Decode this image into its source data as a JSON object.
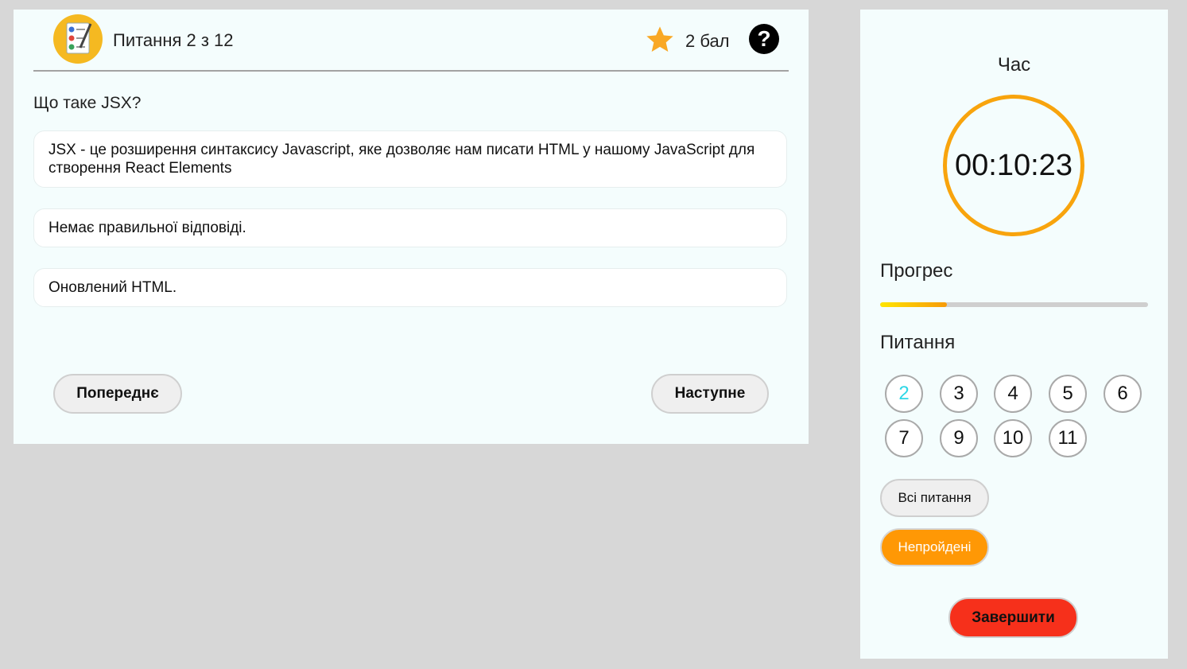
{
  "header": {
    "counter": "Питання 2 з 12",
    "points": "2 бал",
    "help": "?"
  },
  "question": {
    "text": "Що таке JSX?",
    "answers": [
      "JSX - це розширення синтаксису Javascript, яке дозволяє нам писати HTML у нашому JavaScript для створення React Elements",
      "Немає правильної відповіді.",
      "Оновлений HTML."
    ]
  },
  "nav": {
    "prev": "Попереднє",
    "next": "Наступне"
  },
  "sidebar": {
    "time_label": "Час",
    "timer": "00:10:23",
    "progress_label": "Прогрес",
    "progress_fraction": 0.25,
    "questions_label": "Питання",
    "question_numbers": [
      "2",
      "3",
      "4",
      "5",
      "6",
      "7",
      "9",
      "10",
      "11"
    ],
    "current_question": "2",
    "all_questions": "Всі питання",
    "unanswered": "Непройдені",
    "finish": "Завершити"
  },
  "colors": {
    "accent_orange": "#f8a40d",
    "finish_red": "#f6301b",
    "current_question": "#2ed7e6"
  },
  "icons": [
    "quiz-checklist-icon",
    "star-icon",
    "help-icon"
  ]
}
